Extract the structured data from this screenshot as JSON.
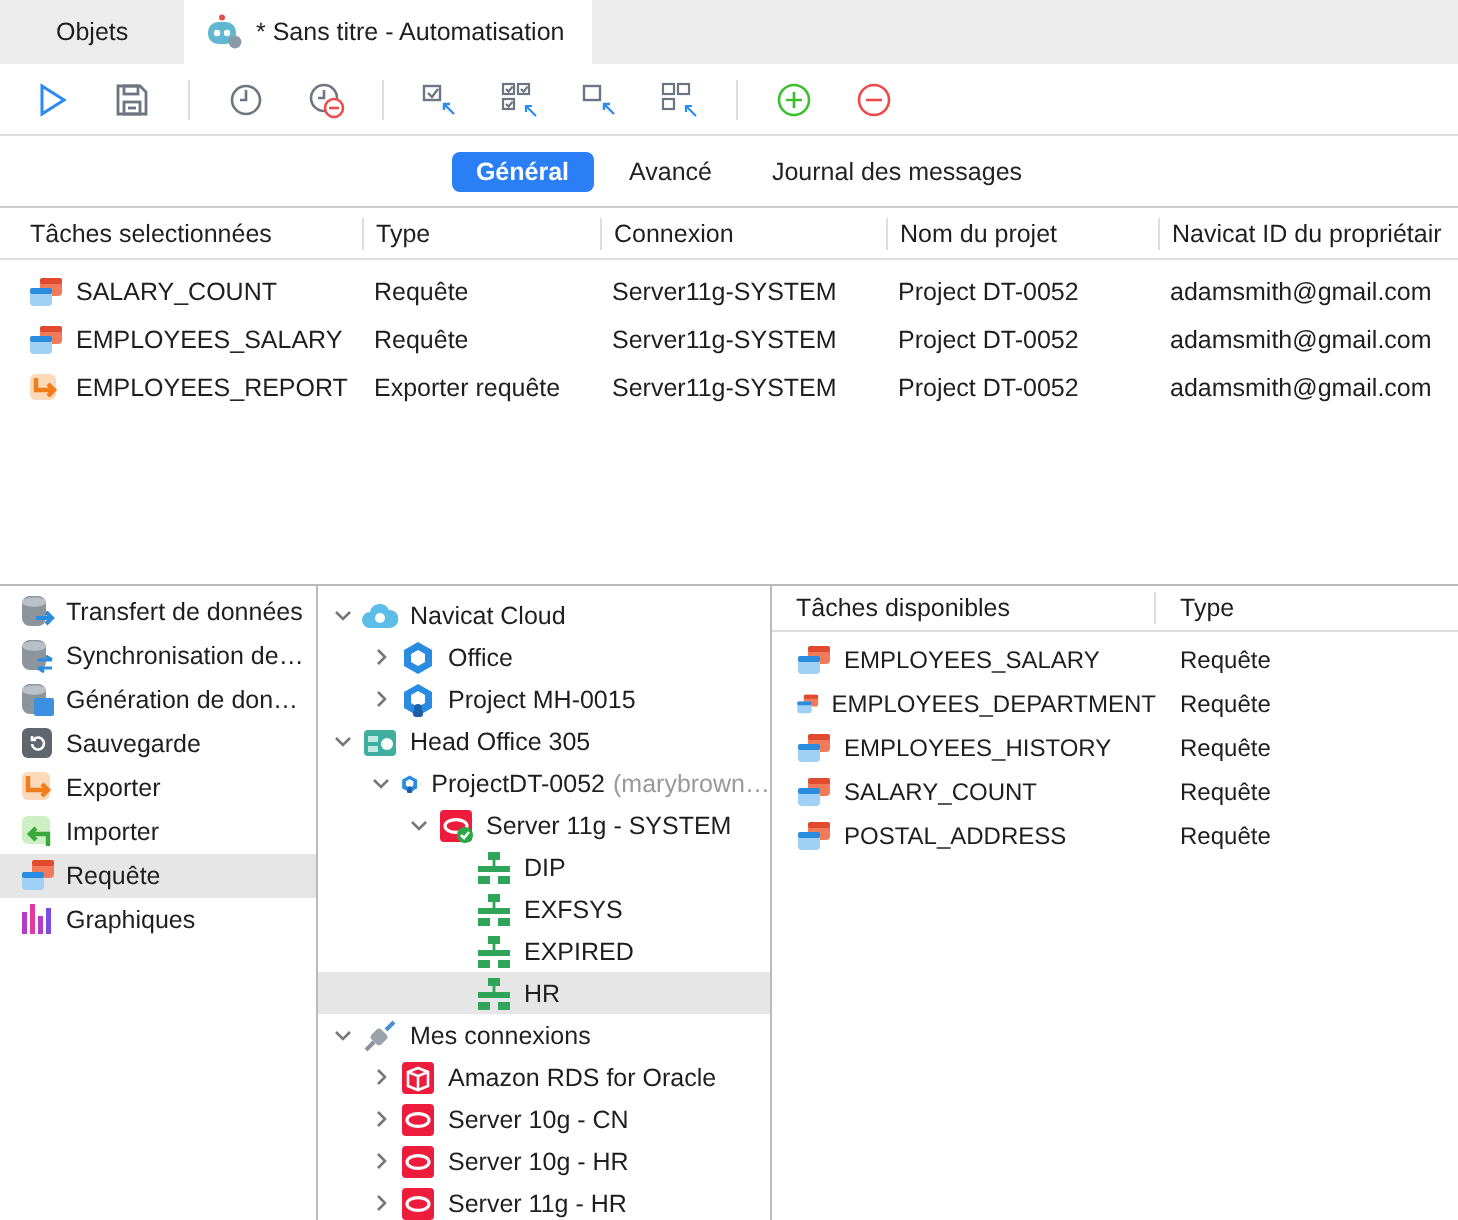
{
  "tabs": [
    {
      "label": "Objets",
      "selected": false,
      "kind": "plain"
    },
    {
      "label": "* Sans titre - Automatisation",
      "selected": true,
      "kind": "robot"
    }
  ],
  "toolbar": [
    {
      "kind": "run"
    },
    {
      "kind": "save"
    },
    {
      "kind": "separator"
    },
    {
      "kind": "schedule"
    },
    {
      "kind": "unschedule"
    },
    {
      "kind": "separator"
    },
    {
      "kind": "select-one"
    },
    {
      "kind": "select-all"
    },
    {
      "kind": "deselect-one"
    },
    {
      "kind": "deselect-all"
    },
    {
      "kind": "separator"
    },
    {
      "kind": "add"
    },
    {
      "kind": "remove"
    }
  ],
  "subtabs": [
    {
      "label": "Général",
      "selected": true
    },
    {
      "label": "Avancé",
      "selected": false
    },
    {
      "label": "Journal des messages",
      "selected": false
    }
  ],
  "selected_table": {
    "columns": [
      "Tâches selectionnées",
      "Type",
      "Connexion",
      "Nom du projet",
      "Navicat ID du propriétair"
    ],
    "rows": [
      {
        "kind": "query",
        "cells": [
          "SALARY_COUNT",
          "Requête",
          "Server11g-SYSTEM",
          "Project DT-0052",
          "adamsmith@gmail.com"
        ]
      },
      {
        "kind": "query",
        "cells": [
          "EMPLOYEES_SALARY",
          "Requête",
          "Server11g-SYSTEM",
          "Project DT-0052",
          "adamsmith@gmail.com"
        ]
      },
      {
        "kind": "export",
        "cells": [
          "EMPLOYEES_REPORT",
          "Exporter requête",
          "Server11g-SYSTEM",
          "Project DT-0052",
          "adamsmith@gmail.com"
        ]
      }
    ]
  },
  "sidebar": {
    "items": [
      {
        "label": "Transfert de données",
        "kind": "transfer",
        "selected": false
      },
      {
        "label": "Synchronisation de…",
        "kind": "sync",
        "selected": false
      },
      {
        "label": "Génération de don…",
        "kind": "generate",
        "selected": false
      },
      {
        "label": "Sauvegarde",
        "kind": "backup",
        "selected": false
      },
      {
        "label": "Exporter",
        "kind": "export",
        "selected": false
      },
      {
        "label": "Importer",
        "kind": "import",
        "selected": false
      },
      {
        "label": "Requête",
        "kind": "query",
        "selected": true
      },
      {
        "label": "Graphiques",
        "kind": "chart",
        "selected": false
      }
    ]
  },
  "tree": [
    {
      "label": "Navicat Cloud",
      "kind": "cloud",
      "expanded": true,
      "selected": false,
      "children": [
        {
          "label": "Office",
          "kind": "project",
          "expanded": false,
          "selected": false
        },
        {
          "label": "Project MH-0015",
          "kind": "shared-project",
          "expanded": false,
          "selected": false
        }
      ]
    },
    {
      "label": "Head Office 305",
      "kind": "server-cloud",
      "expanded": true,
      "selected": false,
      "children": [
        {
          "label": "ProjectDT-0052",
          "note": "(marybrown…",
          "kind": "shared-project",
          "expanded": true,
          "selected": false,
          "children": [
            {
              "label": "Server 11g - SYSTEM",
              "kind": "oracle-connected",
              "expanded": true,
              "selected": false,
              "children": [
                {
                  "label": "DIP",
                  "kind": "schema",
                  "selected": false
                },
                {
                  "label": "EXFSYS",
                  "kind": "schema",
                  "selected": false
                },
                {
                  "label": "EXPIRED",
                  "kind": "schema",
                  "selected": false
                },
                {
                  "label": "HR",
                  "kind": "schema",
                  "selected": true
                }
              ]
            }
          ]
        }
      ]
    },
    {
      "label": "Mes connexions",
      "kind": "plug",
      "expanded": true,
      "selected": false,
      "children": [
        {
          "label": "Amazon RDS for Oracle",
          "kind": "aws",
          "expanded": false,
          "selected": false
        },
        {
          "label": "Server 10g - CN",
          "kind": "oracle",
          "expanded": false,
          "selected": false
        },
        {
          "label": "Server 10g - HR",
          "kind": "oracle",
          "expanded": false,
          "selected": false
        },
        {
          "label": "Server 11g - HR",
          "kind": "oracle",
          "expanded": false,
          "selected": false
        }
      ]
    }
  ],
  "available_table": {
    "columns": [
      "Tâches disponibles",
      "Type"
    ],
    "rows": [
      {
        "kind": "query",
        "cells": [
          "EMPLOYEES_SALARY",
          "Requête"
        ]
      },
      {
        "kind": "query",
        "cells": [
          "EMPLOYEES_DEPARTMENT",
          "Requête"
        ]
      },
      {
        "kind": "query",
        "cells": [
          "EMPLOYEES_HISTORY",
          "Requête"
        ]
      },
      {
        "kind": "query",
        "cells": [
          "SALARY_COUNT",
          "Requête"
        ]
      },
      {
        "kind": "query",
        "cells": [
          "POSTAL_ADDRESS",
          "Requête"
        ]
      }
    ]
  }
}
